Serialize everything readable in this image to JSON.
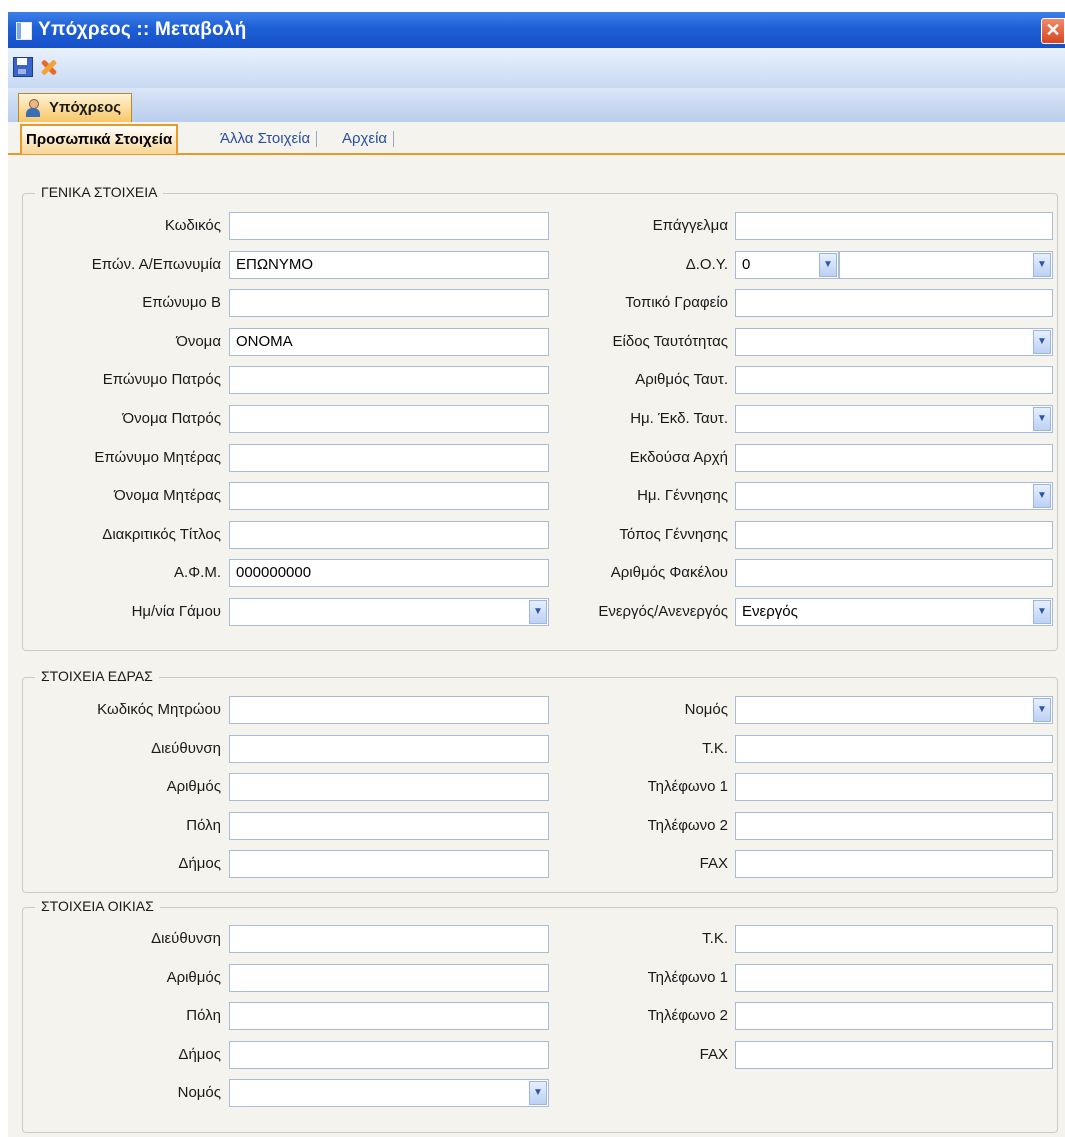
{
  "window": {
    "title": "Υπόχρεος :: Μεταβολή"
  },
  "toolbar": {
    "save_icon": "save-icon",
    "tools_icon": "tools-icon"
  },
  "entity_tab": {
    "label": "Υπόχρεος",
    "icon": "person-icon"
  },
  "subtabs": [
    "Προσωπικά Στοιχεία",
    "Άλλα Στοιχεία",
    "Αρχεία"
  ],
  "general": {
    "title": "ΓΕΝΙΚΑ ΣΤΟΙΧΕΙΑ",
    "left": [
      {
        "label": "Κωδικός",
        "value": ""
      },
      {
        "label": "Επών. Α/Επωνυμία",
        "value": "ΕΠΩΝΥΜΟ"
      },
      {
        "label": "Επώνυμο Β",
        "value": ""
      },
      {
        "label": "Όνομα",
        "value": "ΟΝΟΜΑ"
      },
      {
        "label": "Επώνυμο Πατρός",
        "value": ""
      },
      {
        "label": "Όνομα Πατρός",
        "value": ""
      },
      {
        "label": "Επώνυμο Μητέρας",
        "value": ""
      },
      {
        "label": "Όνομα Μητέρας",
        "value": ""
      },
      {
        "label": "Διακριτικός Τίτλος",
        "value": ""
      },
      {
        "label": "Α.Φ.Μ.",
        "value": "000000000"
      },
      {
        "label": "Ημ/νία Γάμου",
        "value": ""
      }
    ],
    "right": [
      {
        "label": "Επάγγελμα",
        "value": ""
      },
      {
        "label": "Δ.Ο.Υ.",
        "value": "0",
        "value2": ""
      },
      {
        "label": "Τοπικό Γραφείο",
        "value": ""
      },
      {
        "label": "Είδος Ταυτότητας",
        "value": ""
      },
      {
        "label": "Αριθμός Ταυτ.",
        "value": ""
      },
      {
        "label": "Ημ. Έκδ. Ταυτ.",
        "value": ""
      },
      {
        "label": "Εκδούσα Αρχή",
        "value": ""
      },
      {
        "label": "Ημ. Γέννησης",
        "value": ""
      },
      {
        "label": "Τόπος Γέννησης",
        "value": ""
      },
      {
        "label": "Αριθμός Φακέλου",
        "value": ""
      },
      {
        "label": "Ενεργός/Ανενεργός",
        "value": "Ενεργός"
      }
    ]
  },
  "seat": {
    "title": "ΣΤΟΙΧΕΙΑ ΕΔΡΑΣ",
    "left": [
      {
        "label": "Κωδικός Μητρώου",
        "value": ""
      },
      {
        "label": "Διεύθυνση",
        "value": ""
      },
      {
        "label": "Αριθμός",
        "value": ""
      },
      {
        "label": "Πόλη",
        "value": ""
      },
      {
        "label": "Δήμος",
        "value": ""
      }
    ],
    "right": [
      {
        "label": "Νομός",
        "value": ""
      },
      {
        "label": "Τ.Κ.",
        "value": ""
      },
      {
        "label": "Τηλέφωνο 1",
        "value": ""
      },
      {
        "label": "Τηλέφωνο 2",
        "value": ""
      },
      {
        "label": "FAX",
        "value": ""
      }
    ]
  },
  "home": {
    "title": "ΣΤΟΙΧΕΙΑ ΟΙΚΙΑΣ",
    "left": [
      {
        "label": "Διεύθυνση",
        "value": ""
      },
      {
        "label": "Αριθμός",
        "value": ""
      },
      {
        "label": "Πόλη",
        "value": ""
      },
      {
        "label": "Δήμος",
        "value": ""
      },
      {
        "label": "Νομός",
        "value": ""
      }
    ],
    "right": [
      {
        "label": "Τ.Κ.",
        "value": ""
      },
      {
        "label": "Τηλέφωνο 1",
        "value": ""
      },
      {
        "label": "Τηλέφωνο 2",
        "value": ""
      },
      {
        "label": "FAX",
        "value": ""
      }
    ]
  }
}
